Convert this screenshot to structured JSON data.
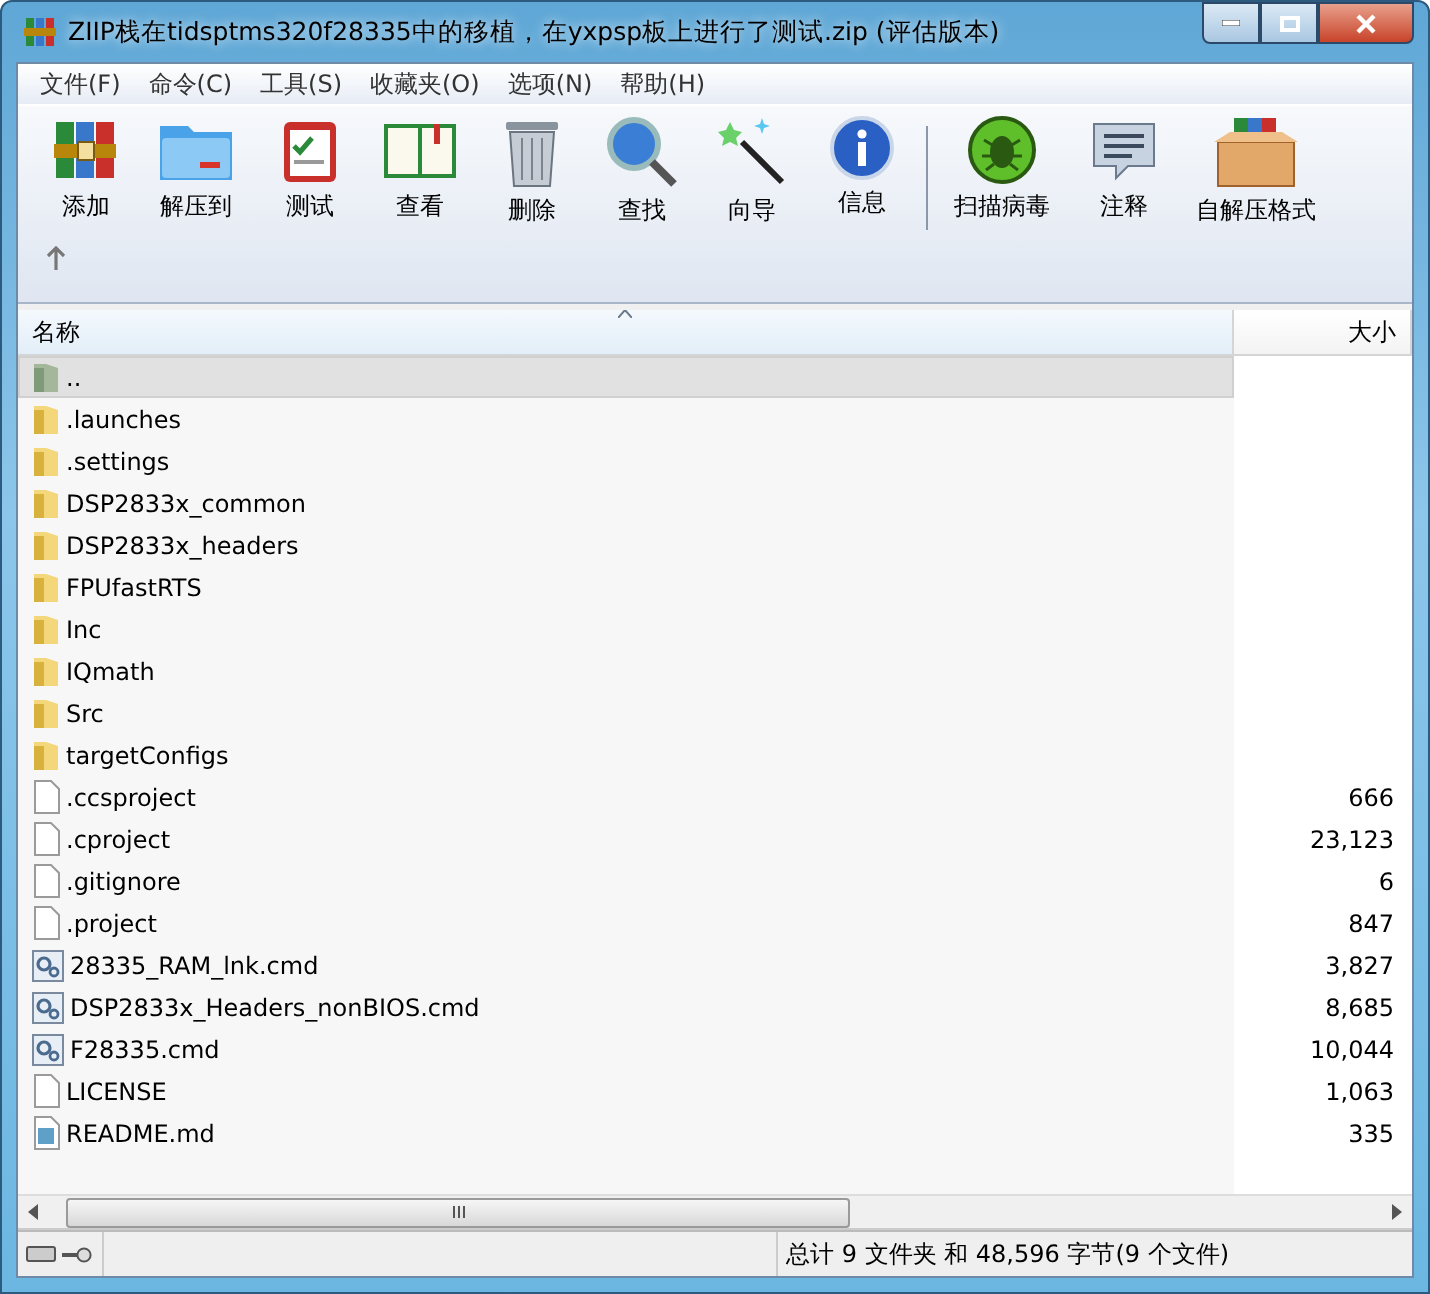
{
  "window": {
    "title": "ZIIP栈在tidsptms320f28335中的移植，在yxpsp板上进行了测试.zip (评估版本)"
  },
  "menu": [
    "文件(F)",
    "命令(C)",
    "工具(S)",
    "收藏夹(O)",
    "选项(N)",
    "帮助(H)"
  ],
  "toolbar": [
    {
      "label": "添加"
    },
    {
      "label": "解压到"
    },
    {
      "label": "测试"
    },
    {
      "label": "查看"
    },
    {
      "label": "删除"
    },
    {
      "label": "查找"
    },
    {
      "label": "向导"
    },
    {
      "label": "信息"
    },
    {
      "label": "扫描病毒"
    },
    {
      "label": "注释"
    },
    {
      "label": "自解压格式"
    }
  ],
  "table": {
    "columns": [
      "名称",
      "大小"
    ],
    "rows": [
      {
        "kind": "parent",
        "name": "..",
        "selected": true
      },
      {
        "kind": "folder",
        "name": ".launches",
        "selected": false
      },
      {
        "kind": "folder",
        "name": ".settings",
        "selected": false
      },
      {
        "kind": "folder",
        "name": "DSP2833x_common",
        "selected": false
      },
      {
        "kind": "folder",
        "name": "DSP2833x_headers",
        "selected": false
      },
      {
        "kind": "folder",
        "name": "FPUfastRTS",
        "selected": false
      },
      {
        "kind": "folder",
        "name": "Inc",
        "selected": false
      },
      {
        "kind": "folder",
        "name": "IQmath",
        "selected": false
      },
      {
        "kind": "folder",
        "name": "Src",
        "selected": false
      },
      {
        "kind": "folder",
        "name": "targetConfigs",
        "selected": false
      },
      {
        "kind": "file",
        "name": ".ccsproject",
        "size": "666",
        "selected": false
      },
      {
        "kind": "file",
        "name": ".cproject",
        "size": "23,123",
        "selected": false
      },
      {
        "kind": "file",
        "name": ".gitignore",
        "size": "6",
        "selected": false
      },
      {
        "kind": "file",
        "name": ".project",
        "size": "847",
        "selected": false
      },
      {
        "kind": "cmd",
        "name": "28335_RAM_lnk.cmd",
        "size": "3,827",
        "selected": false
      },
      {
        "kind": "cmd",
        "name": "DSP2833x_Headers_nonBIOS.cmd",
        "size": "8,685",
        "selected": false
      },
      {
        "kind": "cmd",
        "name": "F28335.cmd",
        "size": "10,044",
        "selected": false
      },
      {
        "kind": "file",
        "name": "LICENSE",
        "size": "1,063",
        "selected": false
      },
      {
        "kind": "md",
        "name": "README.md",
        "size": "335",
        "selected": false
      }
    ]
  },
  "status_bar": {
    "summary": "总计 9 文件夹 和 48,596 字节(9 个文件)"
  }
}
